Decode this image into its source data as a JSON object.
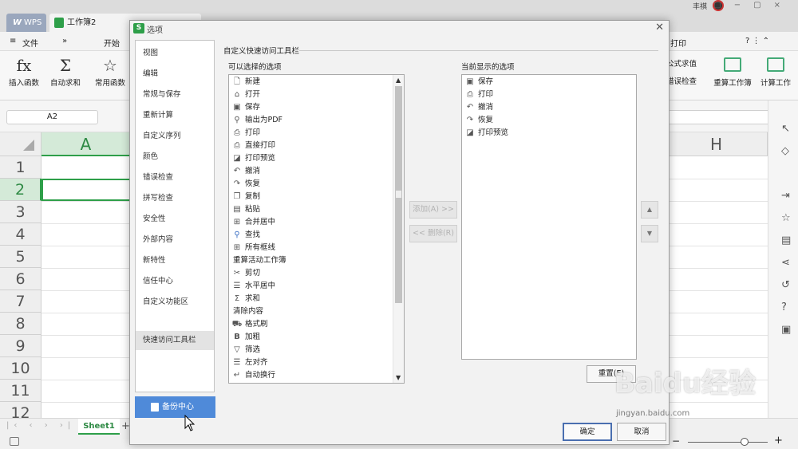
{
  "app": {
    "wps_tab": "WPS",
    "doc_tab": "工作簿2",
    "user": "丰祺"
  },
  "menu": {
    "file": "文件",
    "start": "开始",
    "search": "打印"
  },
  "ribbon": {
    "insert_func": "插入函数",
    "autosum": "自动求和",
    "common_func": "常用函数",
    "formula_eval": "公式求值",
    "error_check": "错误检查",
    "recalc_book": "重算工作簿",
    "calc_sheet": "计算工作"
  },
  "namebox": "A2",
  "grid": {
    "columns": [
      "A",
      "H"
    ],
    "rows": [
      "1",
      "2",
      "3",
      "4",
      "5",
      "6",
      "7",
      "8",
      "9",
      "10",
      "11",
      "12"
    ],
    "selected_cell": "A2"
  },
  "sheet_tab": "Sheet1",
  "dialog": {
    "title": "选项",
    "nav": [
      "视图",
      "编辑",
      "常规与保存",
      "重新计算",
      "自定义序列",
      "颜色",
      "错误检查",
      "拼写检查",
      "安全性",
      "外部内容",
      "新特性",
      "信任中心",
      "自定义功能区",
      "快速访问工具栏"
    ],
    "active_nav": "快速访问工具栏",
    "backup_button": "备份中心",
    "section_title": "自定义快速访问工具栏",
    "available_label": "可以选择的选项",
    "current_label": "当前显示的选项",
    "available_items": [
      {
        "label": "新建",
        "icon": "new-doc-icon"
      },
      {
        "label": "打开",
        "icon": "folder-open-icon"
      },
      {
        "label": "保存",
        "icon": "save-icon"
      },
      {
        "label": "输出为PDF",
        "icon": "pdf-icon"
      },
      {
        "label": "打印",
        "icon": "print-icon"
      },
      {
        "label": "直接打印",
        "icon": "direct-print-icon"
      },
      {
        "label": "打印预览",
        "icon": "print-preview-icon"
      },
      {
        "label": "撤消",
        "icon": "undo-icon"
      },
      {
        "label": "恢复",
        "icon": "redo-icon"
      },
      {
        "label": "复制",
        "icon": "copy-icon"
      },
      {
        "label": "粘贴",
        "icon": "paste-icon"
      },
      {
        "label": "合并居中",
        "icon": "merge-center-icon"
      },
      {
        "label": "查找",
        "icon": "search-icon"
      },
      {
        "label": "所有框线",
        "icon": "borders-icon"
      },
      {
        "label": "重算活动工作簿",
        "icon": ""
      },
      {
        "label": "剪切",
        "icon": "cut-icon"
      },
      {
        "label": "水平居中",
        "icon": "align-center-icon"
      },
      {
        "label": "求和",
        "icon": "sum-icon"
      },
      {
        "label": "清除内容",
        "icon": ""
      },
      {
        "label": "格式刷",
        "icon": "format-painter-icon"
      },
      {
        "label": "加粗",
        "icon": "bold-icon"
      },
      {
        "label": "筛选",
        "icon": "filter-icon"
      },
      {
        "label": "左对齐",
        "icon": "align-left-icon"
      },
      {
        "label": "自动换行",
        "icon": "wrap-icon"
      }
    ],
    "current_items": [
      {
        "label": "保存",
        "icon": "save-icon"
      },
      {
        "label": "打印",
        "icon": "print-icon"
      },
      {
        "label": "撤消",
        "icon": "undo-icon"
      },
      {
        "label": "恢复",
        "icon": "redo-icon"
      },
      {
        "label": "打印预览",
        "icon": "print-preview-icon"
      }
    ],
    "add_button": "添加(A) >>",
    "remove_button": "<< 删除(R)",
    "reset_button": "重置(E)",
    "ok_button": "确定",
    "cancel_button": "取消"
  },
  "watermark": {
    "text": "Baidu经验",
    "url": "jingyan.baidu.com"
  }
}
